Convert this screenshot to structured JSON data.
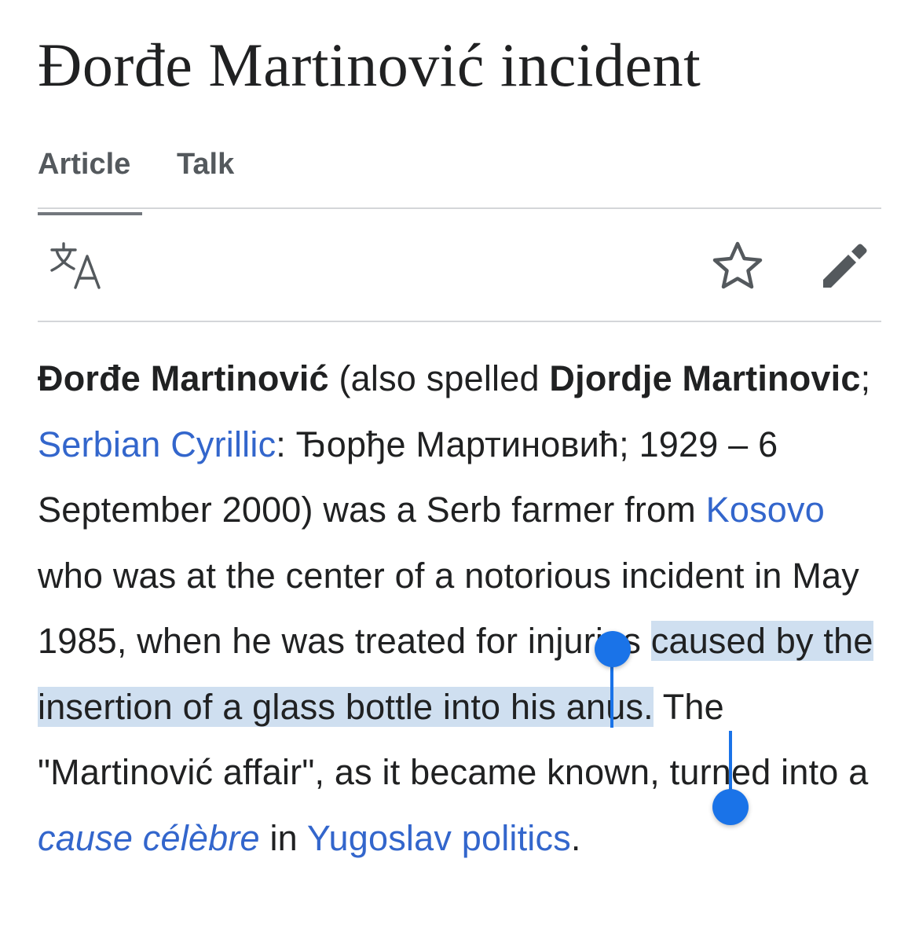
{
  "page": {
    "title": "Đorđe Martinović incident"
  },
  "tabs": [
    {
      "label": "Article",
      "active": true
    },
    {
      "label": "Talk",
      "active": false
    }
  ],
  "toolbar": {
    "language_icon": "translate-icon",
    "watch_icon": "star-icon",
    "edit_icon": "pencil-icon"
  },
  "colors": {
    "link": "#3366cc",
    "selection": "#cfdff0",
    "handle": "#1a73e8"
  },
  "article": {
    "name_bold": "Đorđe Martinović",
    "seg1": " (also spelled ",
    "alt_name_bold": "Djordje Martinovic",
    "seg2": "; ",
    "link_cyrillic": "Serbian Cyrillic",
    "seg3": ": Ђорђе Мартиновић; 1929 – 6 September 2000) was a Serb farmer from ",
    "link_kosovo": "Kosovo",
    "seg4": " who was at the center of a notorious incident in May 1985, when he was treated for injuries ",
    "selected_text": "caused by the insertion of a glass bottle into his anus.",
    "seg5": " The \"Martinović affair\", as it became known, turned into a ",
    "link_cause": "cause célèbre",
    "seg6": " in ",
    "link_yugoslav": "Yugoslav politics",
    "seg7": "."
  }
}
